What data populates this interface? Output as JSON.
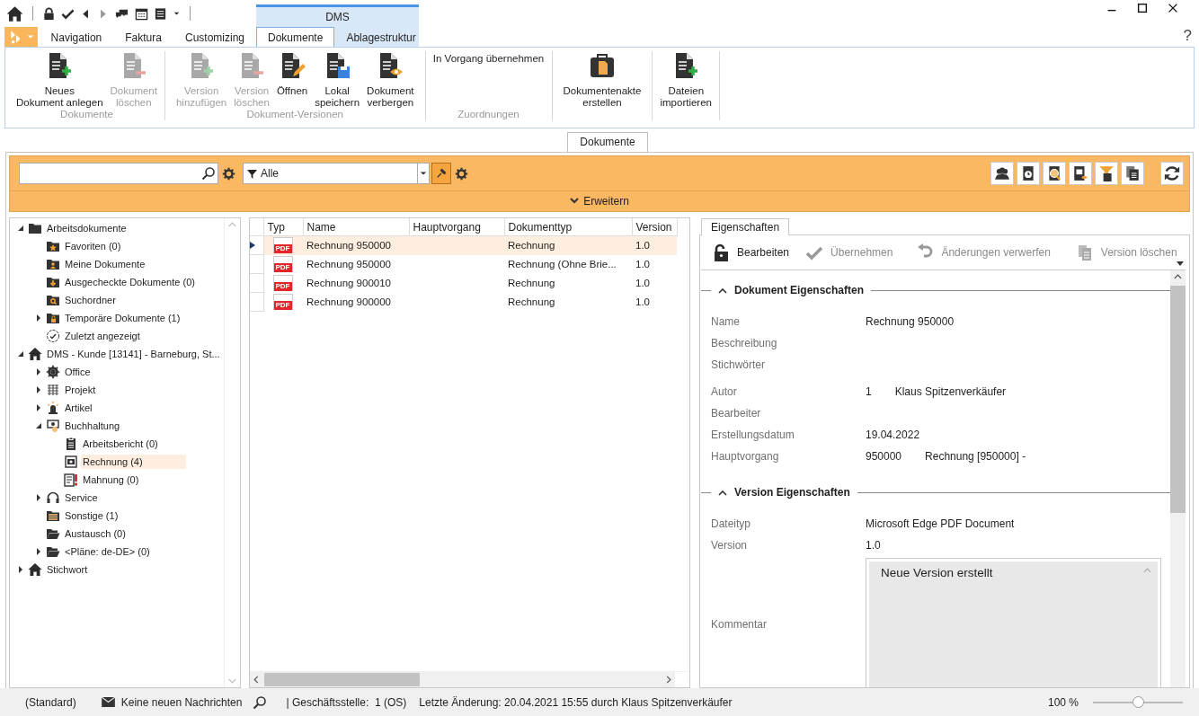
{
  "ribbon": {
    "tabs": [
      {
        "label": "Navigation",
        "selected": false
      },
      {
        "label": "Faktura",
        "selected": false
      },
      {
        "label": "Customizing",
        "selected": false
      }
    ],
    "context_group": {
      "label": "DMS",
      "tabs": [
        {
          "label": "Dokumente",
          "selected": true
        },
        {
          "label": "Ablagestruktur",
          "selected": false
        }
      ]
    },
    "help": "?",
    "groups": [
      {
        "label": "Dokumente",
        "items": [
          {
            "kind": "large",
            "label": "Neues\nDokument anlegen",
            "disabled": false
          },
          {
            "kind": "large",
            "label": "Dokument\nlöschen",
            "disabled": true
          }
        ]
      },
      {
        "label": "Dokument-Versionen",
        "items": [
          {
            "kind": "large",
            "label": "Version\nhinzufügen",
            "disabled": true
          },
          {
            "kind": "large",
            "label": "Version\nlöschen",
            "disabled": true
          },
          {
            "kind": "large",
            "label": "Öffnen",
            "disabled": false
          },
          {
            "kind": "large",
            "label": "Lokal\nspeichern",
            "disabled": false
          },
          {
            "kind": "large",
            "label": "Dokument\nverbergen",
            "disabled": false
          }
        ]
      },
      {
        "label": "Zuordnungen",
        "items": [
          {
            "kind": "small",
            "label": "In Vorgang übernehmen",
            "disabled": false
          }
        ]
      },
      {
        "items": [
          {
            "kind": "large",
            "label": "Dokumentenakte\nerstellen",
            "disabled": false
          }
        ]
      },
      {
        "items": [
          {
            "kind": "large",
            "label": "Dateien\nimportieren",
            "disabled": false
          }
        ]
      }
    ]
  },
  "doc_tabs": [
    {
      "label": "Dokumente",
      "selected": true
    }
  ],
  "toolbar": {
    "filter": {
      "value": "Alle"
    },
    "expand_bar": {
      "label": "Erweitern"
    }
  },
  "tree": [
    {
      "label": "Arbeitsdokumente",
      "expanded": true,
      "selected": false,
      "children": [
        {
          "label": "Favoriten (0)",
          "selected": false
        },
        {
          "label": "Meine Dokumente",
          "selected": false
        },
        {
          "label": "Ausgecheckte Dokumente (0)",
          "selected": false
        },
        {
          "label": "Suchordner",
          "selected": false
        },
        {
          "label": "Temporäre Dokumente (1)",
          "expanded": false,
          "selected": false
        },
        {
          "label": "Zuletzt angezeigt",
          "selected": false
        }
      ]
    },
    {
      "label": "DMS - Kunde [13141] - Barneburg, St...",
      "expanded": true,
      "selected": false,
      "children": [
        {
          "label": "Office",
          "expanded": false,
          "selected": false
        },
        {
          "label": "Projekt",
          "expanded": false,
          "selected": false
        },
        {
          "label": "Artikel",
          "expanded": false,
          "selected": false
        },
        {
          "label": "Buchhaltung",
          "expanded": true,
          "selected": false,
          "children": [
            {
              "label": "Arbeitsbericht (0)",
              "selected": false
            },
            {
              "label": "Rechnung (4)",
              "selected": true
            },
            {
              "label": "Mahnung (0)",
              "selected": false
            }
          ]
        },
        {
          "label": "Service",
          "expanded": false,
          "selected": false
        },
        {
          "label": "Sonstige (1)",
          "selected": false
        },
        {
          "label": "Austausch (0)",
          "selected": false
        },
        {
          "label": "<Pläne: de-DE> (0)",
          "expanded": false,
          "selected": false
        }
      ]
    },
    {
      "label": "Stichwort",
      "expanded": false,
      "selected": false
    }
  ],
  "table": {
    "columns": [
      "Typ",
      "Name",
      "Hauptvorgang",
      "Dokumenttyp",
      "Version"
    ],
    "rows": [
      {
        "typ": "PDF",
        "name": "Rechnung 950000",
        "dokumenttyp": "Rechnung",
        "version": "1.0",
        "selected": true
      },
      {
        "typ": "PDF",
        "name": "Rechnung 950000",
        "dokumenttyp": "Rechnung (Ohne Brie...",
        "version": "1.0",
        "selected": false
      },
      {
        "typ": "PDF",
        "name": "Rechnung 900010",
        "dokumenttyp": "Rechnung",
        "version": "1.0",
        "selected": false
      },
      {
        "typ": "PDF",
        "name": "Rechnung 900000",
        "dokumenttyp": "Rechnung",
        "version": "1.0",
        "selected": false
      }
    ]
  },
  "properties": {
    "tab": {
      "label": "Eigenschaften",
      "selected": true
    },
    "actions": [
      {
        "label": "Bearbeiten",
        "disabled": false
      },
      {
        "label": "Übernehmen",
        "disabled": true
      },
      {
        "label": "Änderungen verwerfen",
        "disabled": true
      },
      {
        "label": "Version löschen",
        "disabled": true
      }
    ],
    "sections": [
      {
        "title": "Dokument Eigenschaften",
        "expanded": true,
        "fields": [
          {
            "kind": "text",
            "label": "Name",
            "values": [
              "Rechnung 950000"
            ]
          },
          {
            "kind": "text",
            "label": "Beschreibung"
          },
          {
            "kind": "text",
            "label": "Stichwörter"
          },
          {
            "kind": "text",
            "label": "Autor",
            "values": [
              "1",
              "Klaus Spitzenverkäufer"
            ]
          },
          {
            "kind": "text",
            "label": "Bearbeiter"
          },
          {
            "kind": "text",
            "label": "Erstellungsdatum",
            "values": [
              "19.04.2022"
            ]
          },
          {
            "kind": "text",
            "label": "Hauptvorgang",
            "values": [
              "950000",
              "Rechnung [950000] -"
            ]
          }
        ]
      },
      {
        "title": "Version Eigenschaften",
        "expanded": true,
        "fields": [
          {
            "kind": "text",
            "label": "Dateityp",
            "values": [
              "Microsoft Edge PDF Document"
            ]
          },
          {
            "kind": "text",
            "label": "Version",
            "values": [
              "1.0"
            ]
          },
          {
            "kind": "memo",
            "label": "Kommentar",
            "values": [
              "Neue Version erstellt"
            ]
          }
        ]
      }
    ]
  },
  "status_bar": {
    "profile": "(Standard)",
    "messages": "Keine neuen Nachrichten",
    "branch": "| Geschäftsstelle:  1 (OS)",
    "last_change": "Letzte Änderung: 20.04.2021 15:55 durch Klaus Spitzenverkäufer",
    "zoom": {
      "reading": "100 %",
      "level": 0.5
    }
  }
}
